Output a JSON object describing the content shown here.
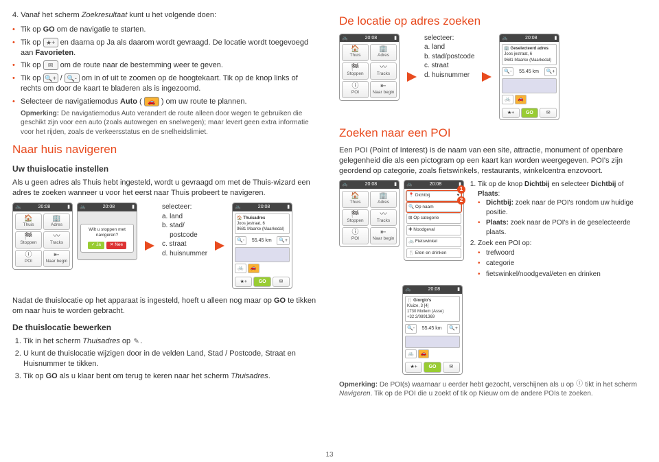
{
  "left": {
    "intro_num": "4.",
    "intro_text": "Vanaf het scherm ",
    "intro_ital": "Zoekresultaat",
    "intro_tail": " kunt u het volgende doen:",
    "b1a": "Tik op ",
    "b1b": "GO",
    "b1c": " om de navigatie te starten.",
    "b2a": "Tik op ",
    "b2b": " en daarna op Ja als daarom wordt gevraagd. De locatie wordt toegevoegd aan ",
    "b2c": "Favorieten",
    "b2d": ".",
    "b3a": "Tik op ",
    "b3b": " om de route naar de bestemming weer te geven.",
    "b4a": "Tik op ",
    "b4slash": " / ",
    "b4b": " om in of uit te zoomen op de hoogtekaart. Tik op de knop links of rechts om door de kaart te bladeren als is ingezoomd.",
    "b5a": "Selecteer de navigatiemodus ",
    "b5b": "Auto",
    "b5c": " ( ",
    "b5d": " ) om uw route te plannen.",
    "b5note_bold": "Opmerking:",
    "b5note": " De navigatiemodus Auto verandert de route alleen door wegen te gebruiken die geschikt zijn voor een auto (zoals autowegen en snelwegen); maar levert geen extra informatie voor het rijden, zoals de verkeersstatus en de snelheidslimiet.",
    "h2a": "Naar huis navigeren",
    "h3a": "Uw thuislocatie instellen",
    "p1": "Als u geen adres als Thuis hebt ingesteld, wordt u gevraagd om met de Thuis-wizard een adres te zoeken wanneer u voor het eerst naar Thuis probeert te navigeren.",
    "sel_label": "selecteer:",
    "sel_a": "a. land",
    "sel_b1": "b. stad/",
    "sel_b2": "    postcode",
    "sel_c": "c. straat",
    "sel_d": "d. huisnummer",
    "p2a": "Nadat de thuislocatie op het apparaat is ingesteld, hoeft u alleen nog maar op ",
    "p2b": "GO",
    "p2c": " te tikken om naar huis te worden gebracht.",
    "h3b": "De thuislocatie bewerken",
    "ol1a": "Tik in het scherm ",
    "ol1b": "Thuisadres",
    "ol1c": " op ",
    "ol2": "U kunt de thuislocatie wijzigen door in de velden Land, Stad / Postcode, Straat en Huisnummer te tikken.",
    "ol3a": "Tik op ",
    "ol3b": "GO",
    "ol3c": " als u klaar bent om terug te keren naar het scherm ",
    "ol3d": "Thuisadres",
    "ol3e": "."
  },
  "right": {
    "h2a": "De locatie op adres zoeken",
    "sel_label": "selecteer:",
    "sel_a": "a. land",
    "sel_b": "b. stad/postcode",
    "sel_c": "c. straat",
    "sel_d": "d. huisnummer",
    "h2b": "Zoeken naar een POI",
    "p1": "Een POI (Point of Interest) is de naam van een site, attractie, monument of openbare gelegenheid die als een pictogram op een kaart kan worden weergegeven. POI's zijn geordend op categorie, zoals fietswinkels, restaurants, winkelcentra enzovoort.",
    "o1a": "Tik op de knop ",
    "o1b": "Dichtbij",
    "o1c": " en selecteer ",
    "o1d": "Dichtbij",
    "o1e": " of ",
    "o1f": "Plaats",
    "o1g": ":",
    "o1s1a": "Dichtbij:",
    "o1s1b": " zoek naar de POI's rondom uw huidige positie.",
    "o1s2a": "Plaats:",
    "o1s2b": " zoek naar de POI's in de geselecteerde plaats.",
    "o2": "Zoek een POI op:",
    "o2s1": "trefwoord",
    "o2s2": "categorie",
    "o2s3": "fietswinkel/noodgeval/eten en drinken",
    "note_bold": "Opmerking:",
    "note1": " De POI(s) waarnaar u eerder hebt gezocht, verschijnen als u op ",
    "note2": " tikt in het scherm ",
    "note_ital": "Navigeren",
    "note3": ". Tik op de POI die u zoekt of tik op Nieuw om de andere POIs te zoeken."
  },
  "phone": {
    "time": "20:08",
    "thuis": "Thuis",
    "adres": "Adres",
    "stoppen": "Stoppen",
    "tracks": "Tracks",
    "poi": "POI",
    "begin": "Naar begin",
    "go": "GO",
    "dist": "55.45",
    "km": "km",
    "thuisadres": "Thuisadres",
    "addr1": "Joos jestraat, 6",
    "addr2": "9681 Maarke (Maarkedal)",
    "dialog_q": "Wilt u stoppen met navigeren?",
    "ja": "Ja",
    "nee": "Nee",
    "dichtbij": "Dichtbij",
    "opnaam": "Op naam",
    "opcat": "Op categorie",
    "nood": "Noodgeval",
    "fiets": "Fietswinkel",
    "eten": "Eten en drinken",
    "gesel": "Geselecteerd adres",
    "gaddr1": "Joos jestraat, 6",
    "gaddr2": "9681 Maarke (Maarkedal)",
    "giorgio": "Giorgio's",
    "gaddr": "Kluize, 3 [4]",
    "gcity": "1730 Mollem (Asse)",
    "gphone": "+32 2/0891369"
  },
  "page": "13"
}
